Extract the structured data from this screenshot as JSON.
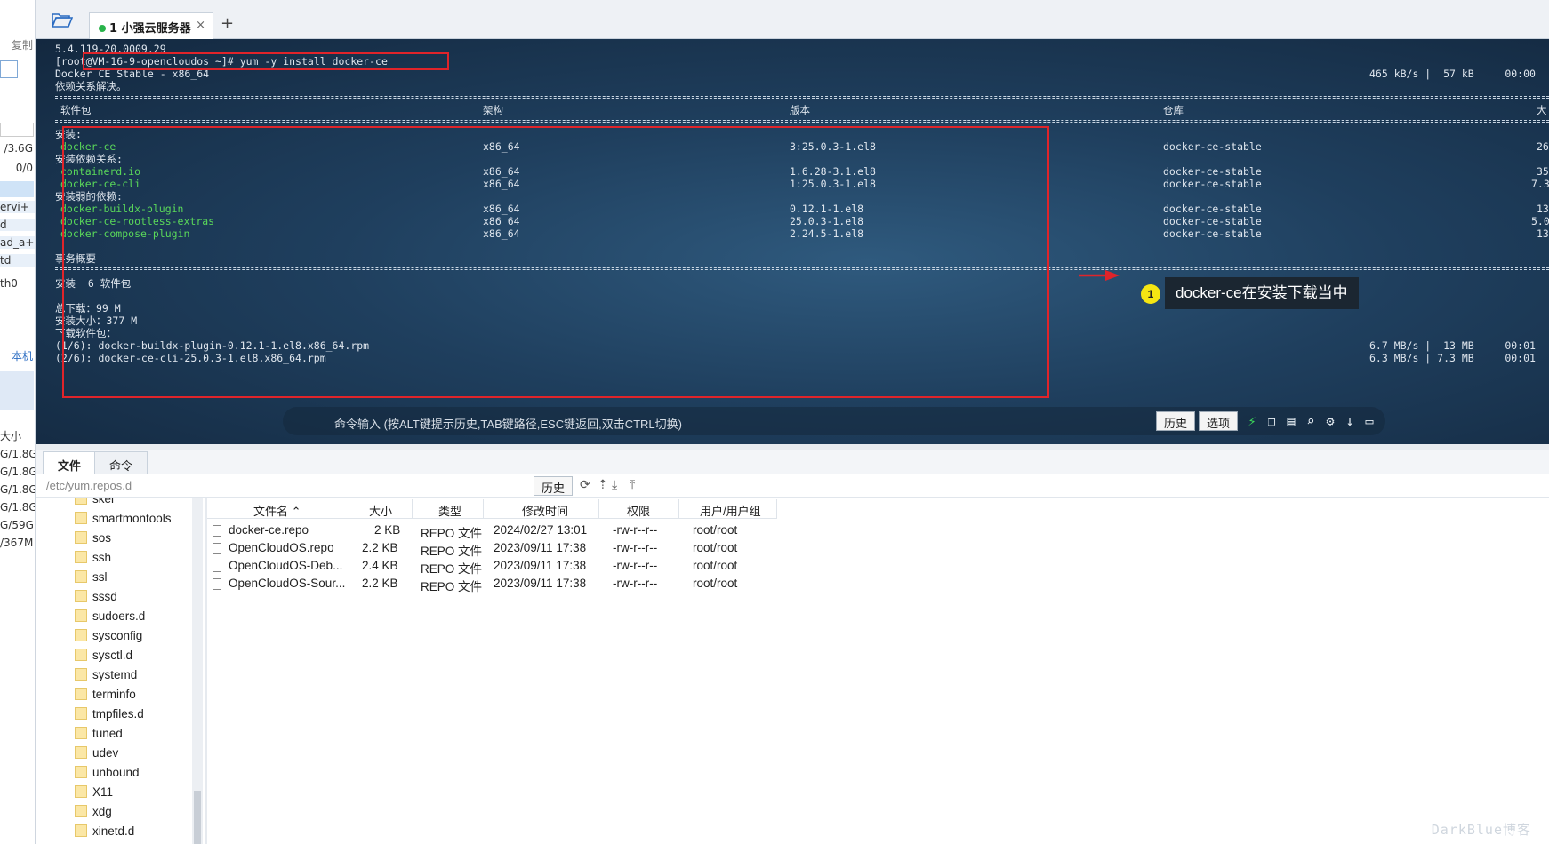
{
  "left_panel": {
    "items": [
      "复制",
      "/3.6G",
      "0/0",
      "ervi+",
      "d",
      "ad_a+",
      "td",
      "th0",
      "本机",
      "大小",
      "G/1.8G",
      "G/1.8G",
      "G/1.8G",
      "G/1.8G",
      "G/59G",
      "/367M"
    ]
  },
  "tabs": {
    "active_label": "1 小强云服务器",
    "close": "×",
    "add": "+"
  },
  "terminal": {
    "lines": {
      "l1": "5.4.119-20.0009.29",
      "l2": "[root@VM-16-9-opencloudos ~]# yum -y install docker-ce",
      "l3": "Docker CE Stable - x86_64",
      "l3_stats": "465 kB/s |  57 kB     00:00",
      "l4": "依赖关系解决。",
      "h_pkg": "软件包",
      "h_arch": "架构",
      "h_ver": "版本",
      "h_repo": "仓库",
      "h_size": "大",
      "sec_install": "安装:",
      "sec_deps": "安装依赖关系:",
      "sec_weak": "安装弱的依赖:",
      "summary": "事务概要",
      "install_count": "安装  6 软件包",
      "total_download": "总下载：99 M",
      "install_size": "安装大小：377 M",
      "downloading": "下载软件包：",
      "dl1": "(1/6): docker-buildx-plugin-0.12.1-1.el8.x86_64.rpm",
      "dl1_stats": "6.7 MB/s |  13 MB     00:01",
      "dl2": "(2/6): docker-ce-cli-25.0.3-1.el8.x86_64.rpm",
      "dl2_stats": "6.3 MB/s | 7.3 MB     00:01"
    },
    "packages": [
      {
        "name": "docker-ce",
        "arch": "x86_64",
        "version": "3:25.0.3-1.el8",
        "repo": "docker-ce-stable",
        "size": "26"
      },
      {
        "name": "containerd.io",
        "arch": "x86_64",
        "version": "1.6.28-3.1.el8",
        "repo": "docker-ce-stable",
        "size": "35"
      },
      {
        "name": "docker-ce-cli",
        "arch": "x86_64",
        "version": "1:25.0.3-1.el8",
        "repo": "docker-ce-stable",
        "size": "7.3"
      },
      {
        "name": "docker-buildx-plugin",
        "arch": "x86_64",
        "version": "0.12.1-1.el8",
        "repo": "docker-ce-stable",
        "size": "13"
      },
      {
        "name": "docker-ce-rootless-extras",
        "arch": "x86_64",
        "version": "25.0.3-1.el8",
        "repo": "docker-ce-stable",
        "size": "5.0"
      },
      {
        "name": "docker-compose-plugin",
        "arch": "x86_64",
        "version": "2.24.5-1.el8",
        "repo": "docker-ce-stable",
        "size": "13"
      }
    ],
    "annotation": {
      "badge": "1",
      "text": "docker-ce在安装下载当中"
    },
    "cmdbar": {
      "placeholder": "命令输入 (按ALT键提示历史,TAB键路径,ESC键返回,双击CTRL切换)",
      "history_label": "历史",
      "options_label": "选项"
    }
  },
  "bottom": {
    "tabs": [
      "文件",
      "命令"
    ],
    "path": "/etc/yum.repos.d",
    "history_label": "历史",
    "tree": [
      "skel",
      "smartmontools",
      "sos",
      "ssh",
      "ssl",
      "sssd",
      "sudoers.d",
      "sysconfig",
      "sysctl.d",
      "systemd",
      "terminfo",
      "tmpfiles.d",
      "tuned",
      "udev",
      "unbound",
      "X11",
      "xdg",
      "xinetd.d"
    ],
    "columns": [
      "文件名",
      "大小",
      "类型",
      "修改时间",
      "权限",
      "用户/用户组"
    ],
    "files": [
      {
        "name": "docker-ce.repo",
        "size": "2 KB",
        "type": "REPO 文件",
        "mtime": "2024/02/27 13:01",
        "perm": "-rw-r--r--",
        "owner": "root/root"
      },
      {
        "name": "OpenCloudOS.repo",
        "size": "2.2 KB",
        "type": "REPO 文件",
        "mtime": "2023/09/11 17:38",
        "perm": "-rw-r--r--",
        "owner": "root/root"
      },
      {
        "name": "OpenCloudOS-Deb...",
        "size": "2.4 KB",
        "type": "REPO 文件",
        "mtime": "2023/09/11 17:38",
        "perm": "-rw-r--r--",
        "owner": "root/root"
      },
      {
        "name": "OpenCloudOS-Sour...",
        "size": "2.2 KB",
        "type": "REPO 文件",
        "mtime": "2023/09/11 17:38",
        "perm": "-rw-r--r--",
        "owner": "root/root"
      }
    ]
  },
  "watermark": "DarkBlue博客"
}
